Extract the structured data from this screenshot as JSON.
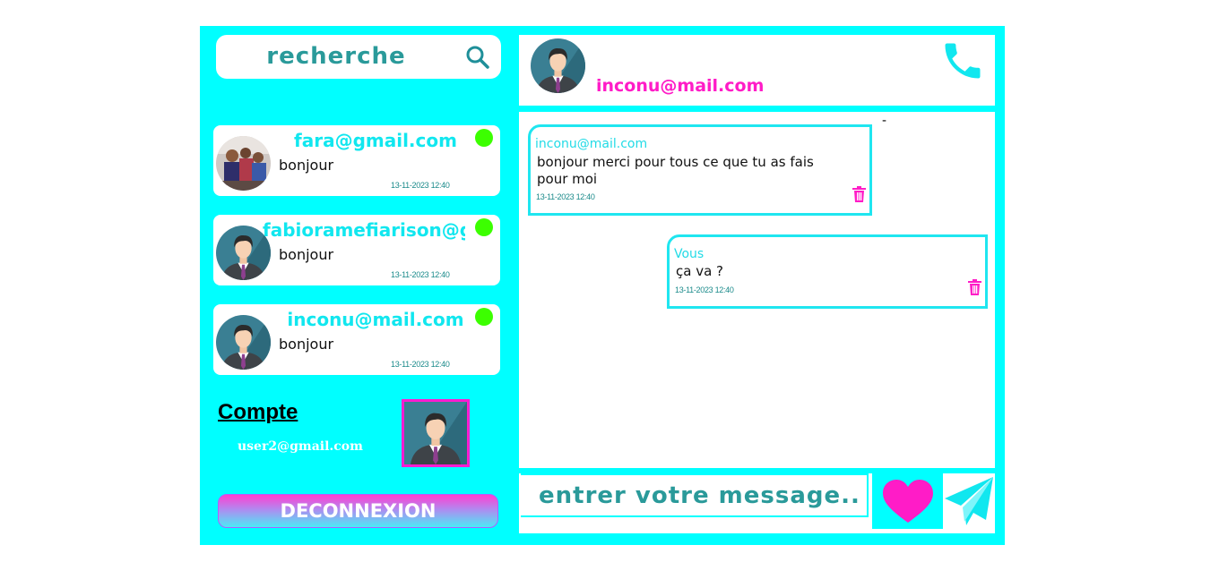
{
  "search": {
    "placeholder": "recherche"
  },
  "contacts": [
    {
      "email": "fara@gmail.com",
      "preview": "bonjour",
      "time": "13-11-2023 12:40"
    },
    {
      "email": "fabioramefiarison@gmail.com",
      "preview": "bonjour",
      "time": "13-11-2023 12:40"
    },
    {
      "email": "inconu@mail.com",
      "preview": "bonjour",
      "time": "13-11-2023 12:40"
    }
  ],
  "account": {
    "label": "Compte",
    "email": "user2@gmail.com"
  },
  "logout_label": "DECONNEXION",
  "chat": {
    "header_name": "inconu@mail.com",
    "separator": "-",
    "messages": [
      {
        "sender": "inconu@mail.com",
        "text": "bonjour merci pour tous ce que tu as fais pour moi",
        "time": "13-11-2023 12:40"
      },
      {
        "sender": "Vous",
        "text": "ça va ?",
        "time": "13-11-2023 12:40"
      }
    ]
  },
  "composer": {
    "placeholder": "entrer votre message.."
  },
  "colors": {
    "background": "#00ffff",
    "accent_pink": "#ff1cc7",
    "online": "#3cff00",
    "teal_text": "#2a9a9a"
  },
  "icons": {
    "search": "search-icon",
    "phone": "phone-icon",
    "trash": "trash-icon",
    "heart": "heart-icon",
    "send": "send-icon"
  }
}
